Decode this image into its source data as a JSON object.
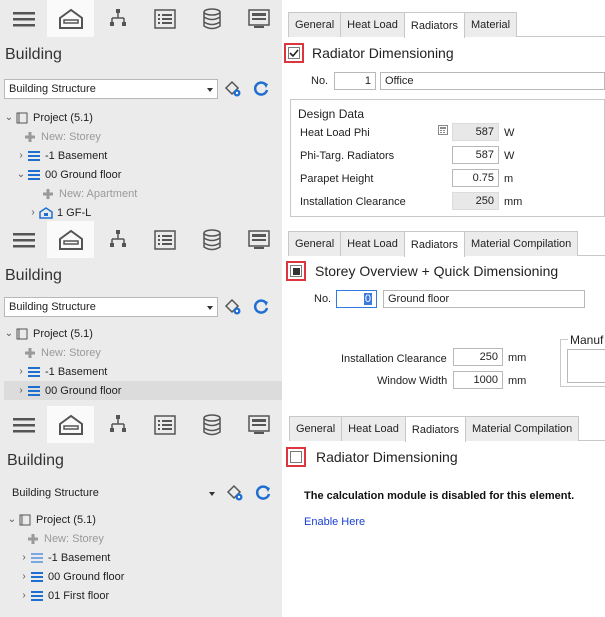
{
  "nav": {
    "title": "Building",
    "dropdown_value": "Building Structure",
    "icons": [
      "hamburger-menu-icon",
      "building-house-icon",
      "network-tree-icon",
      "list-document-icon",
      "database-icon",
      "screen-table-icon"
    ]
  },
  "tabs": {
    "general": "General",
    "heat_load": "Heat Load",
    "radiators": "Radiators",
    "material": "Material",
    "material_compilation": "Material Compilation"
  },
  "panel1": {
    "tree": {
      "project": "Project (5.1)",
      "new_storey": "New: Storey",
      "basement": "-1 Basement",
      "ground": "00 Ground floor",
      "new_apartment": "New: Apartment",
      "gf": "1 GF-L"
    },
    "section_title": "Radiator Dimensioning",
    "no_label": "No.",
    "no_value": "1",
    "room_name": "Office",
    "design_data_title": "Design Data",
    "rows": [
      {
        "label": "Heat Load Phi",
        "value": "587",
        "unit": "W"
      },
      {
        "label": "Phi-Targ. Radiators",
        "value": "587",
        "unit": "W"
      },
      {
        "label": "Parapet Height",
        "value": "0.75",
        "unit": "m"
      },
      {
        "label": "Installation Clearance",
        "value": "250",
        "unit": "mm"
      }
    ]
  },
  "panel2": {
    "tree": {
      "project": "Project (5.1)",
      "new_storey": "New: Storey",
      "basement": "-1 Basement",
      "ground": "00 Ground floor"
    },
    "section_title": "Storey Overview + Quick Dimensioning",
    "no_label": "No.",
    "no_value": "0",
    "storey_name": "Ground floor",
    "installation_clearance_label": "Installation Clearance",
    "installation_clearance_value": "250",
    "installation_clearance_unit": "mm",
    "window_width_label": "Window Width",
    "window_width_value": "1000",
    "window_width_unit": "mm",
    "manuf_label": "Manuf"
  },
  "panel3": {
    "tree": {
      "project": "Project (5.1)",
      "new_storey": "New: Storey",
      "basement": "-1 Basement",
      "ground": "00 Ground floor",
      "first": "01 First floor"
    },
    "section_title": "Radiator Dimensioning",
    "disabled_msg": "The calculation module is disabled for this element.",
    "enable_link": "Enable Here"
  },
  "colors": {
    "accent_blue": "#1f6fd1",
    "highlight_red": "#d9373b",
    "link_blue": "#1a3fd0"
  }
}
